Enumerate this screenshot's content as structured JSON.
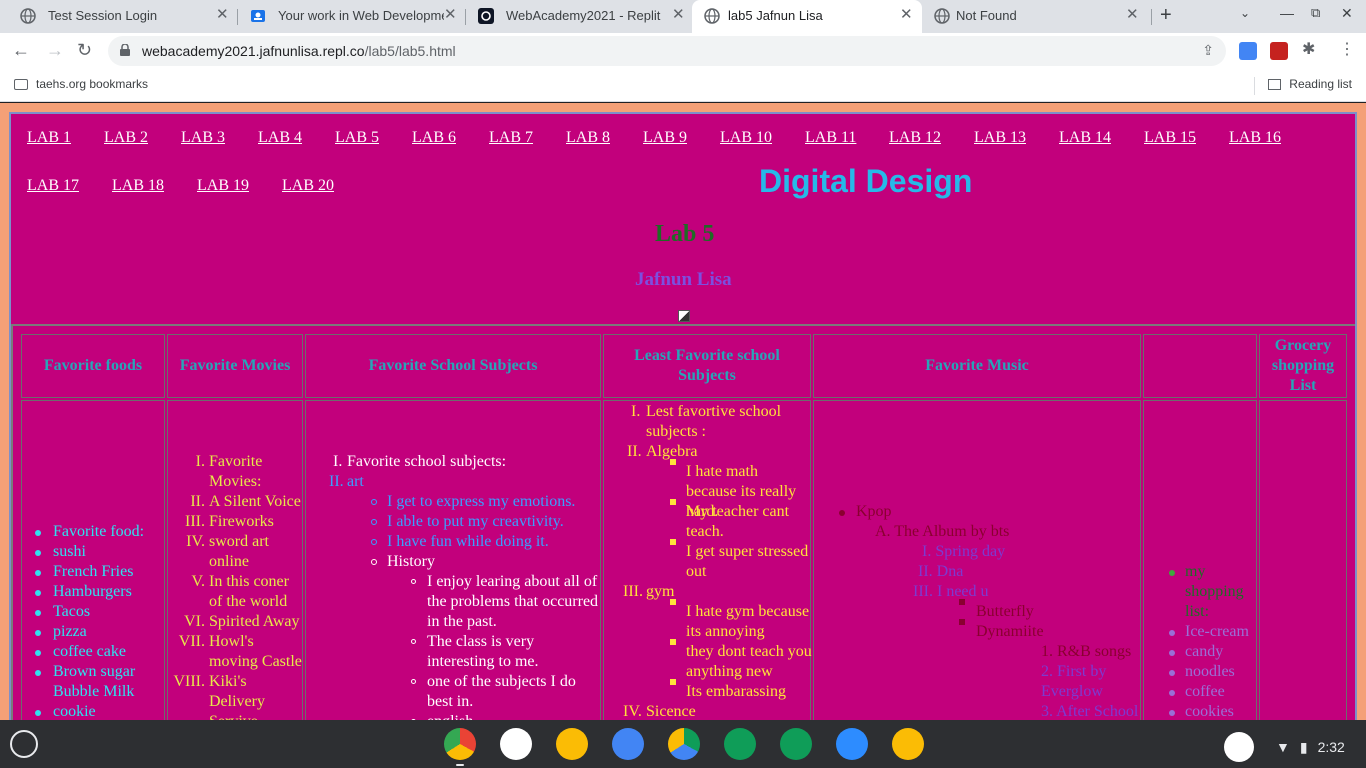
{
  "browser": {
    "tabs": [
      {
        "title": "Test Session Login",
        "active": false
      },
      {
        "title": "Your work in Web Developmen",
        "active": false
      },
      {
        "title": "WebAcademy2021 - Replit",
        "active": false
      },
      {
        "title": "lab5 Jafnun Lisa",
        "active": true
      },
      {
        "title": "Not Found",
        "active": false
      }
    ],
    "url_host": "webacademy2021.jafnunlisa.repl.co",
    "url_path": "/lab5/lab5.html",
    "bookmark_folder": "taehs.org bookmarks",
    "reading_list": "Reading list"
  },
  "page": {
    "nav_links": [
      "LAB 1",
      "LAB 2",
      "LAB 3",
      "LAB 4",
      "LAB 5",
      "LAB 6",
      "LAB 7",
      "LAB 8",
      "LAB 9",
      "LAB 10",
      "LAB 11",
      "LAB 12",
      "LAB 13",
      "LAB 14",
      "LAB 15",
      "LAB 16",
      "LAB 17",
      "LAB 18",
      "LAB 19",
      "LAB 20"
    ],
    "site_title": "Digital Design",
    "lab_title": "Lab 5",
    "author": "Jafnun Lisa",
    "headers": [
      "Favorite foods",
      "Favorite Movies",
      "Favorite School Subjects",
      "Least Favorite school Subjects",
      "Favorite Music",
      "",
      "Grocery shopping List"
    ],
    "foods": [
      "Favorite food:",
      "sushi",
      "French Fries",
      "Hamburgers",
      "Tacos",
      "pizza",
      "coffee cake",
      "Brown sugar Bubble Milk",
      "cookie"
    ],
    "movies": {
      "numerals": [
        "I.",
        "II.",
        "III.",
        "IV.",
        "V.",
        "VI.",
        "VII.",
        "VIII."
      ],
      "items": [
        "Favorite Movies:",
        "A Silent Voice",
        "Fireworks",
        "sword art online",
        "In this coner of the world",
        "Spirited Away",
        "Howl's moving Castle",
        "Kiki's Delivery Servive"
      ]
    },
    "subjects": {
      "item1": "Favorite school subjects:",
      "item2": "art",
      "art_reasons": [
        "I get to express my emotions.",
        "I able to put my creavtivity.",
        "I have fun while doing it."
      ],
      "history": "History",
      "history_reasons": [
        "I enjoy learing about all of the problems that occurred in the past.",
        "The class is very interesting to me.",
        "one of the subjects I do best in."
      ],
      "english": "english"
    },
    "least": {
      "intro": "Lest favortive school subjects :",
      "algebra": "Algebra",
      "algebra_reasons": [
        "I hate math because its really hard.",
        "My teacher cant teach.",
        "I get super stressed out"
      ],
      "gym": "gym",
      "gym_reasons": [
        "I hate gym because its annoying",
        "they dont teach you anything new",
        "Its embarassing"
      ],
      "science": "Sicence"
    },
    "music": {
      "kpop": "Kpop",
      "album": "A. The Album by bts",
      "roman_songs": [
        "I. Spring day",
        "II. Dna",
        "III. I need u"
      ],
      "sub_songs": [
        "Butterfly",
        "Dynamiite"
      ],
      "numbered": [
        "1. R&B songs",
        "2. First by Everglow",
        "3. After School"
      ]
    },
    "grocery": {
      "heading": "my shopping list:",
      "items": [
        "Ice-cream",
        "candy",
        "noodles",
        "coffee",
        "cookies"
      ]
    }
  },
  "shelf": {
    "time": "2:32"
  },
  "colors": {
    "page_bg": "#c2007c",
    "outer_bg": "#f4a077",
    "title_blue": "#27b9e8",
    "header_teal": "#27a6b8",
    "food_cyan": "#2ee3f0",
    "movie_yellow": "#e8e84a",
    "subject_blue": "#3aa0ff",
    "least_yellow": "#ffe23a",
    "music_dark": "#8a0030",
    "music_purple": "#7d3ad1"
  }
}
